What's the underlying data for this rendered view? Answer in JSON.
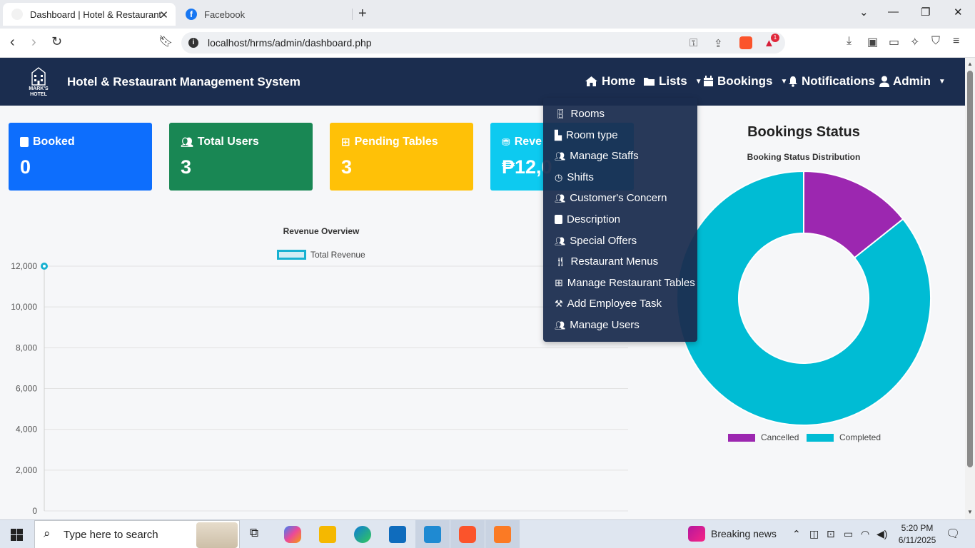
{
  "browser": {
    "tabs": [
      {
        "title": "Dashboard | Hotel & Restaurant",
        "active": true
      },
      {
        "title": "Facebook",
        "active": false
      }
    ],
    "url": "localhost/hrms/admin/dashboard.php",
    "notification_badge": "1"
  },
  "navbar": {
    "logo_text": "MARK'S HOTEL",
    "brand": "Hotel & Restaurant Management System",
    "items": [
      {
        "label": "Home",
        "icon": "home-icon"
      },
      {
        "label": "Lists",
        "icon": "folder-icon",
        "dropdown": true
      },
      {
        "label": "Bookings",
        "icon": "calendar-icon",
        "dropdown": true
      },
      {
        "label": "Notifications",
        "icon": "bell-icon"
      },
      {
        "label": "Admin",
        "icon": "user-icon",
        "dropdown": true
      }
    ]
  },
  "cards": [
    {
      "title": "Booked",
      "value": "0",
      "color": "#0d6efd",
      "icon": "book-icon"
    },
    {
      "title": "Total Users",
      "value": "3",
      "color": "#198754",
      "icon": "users-icon"
    },
    {
      "title": "Pending Tables",
      "value": "3",
      "color": "#ffc107",
      "icon": "table-icon"
    },
    {
      "title": "Reve",
      "value": "₱12,0",
      "color": "#0dcaf0",
      "icon": "coins-icon"
    }
  ],
  "lists_menu": [
    {
      "label": "Rooms",
      "icon": "door-icon"
    },
    {
      "label": "Room type",
      "icon": "building-icon"
    },
    {
      "label": "Manage Staffs",
      "icon": "users-icon"
    },
    {
      "label": "Shifts",
      "icon": "clock-icon"
    },
    {
      "label": "Customer's Concern",
      "icon": "users-icon"
    },
    {
      "label": "Description",
      "icon": "book-icon"
    },
    {
      "label": "Special Offers",
      "icon": "users-icon"
    },
    {
      "label": "Restaurant Menus",
      "icon": "utensils-icon"
    },
    {
      "label": "Manage Restaurant Tables",
      "icon": "table-icon"
    },
    {
      "label": "Add Employee Task",
      "icon": "hammer-icon"
    },
    {
      "label": "Manage Users",
      "icon": "users-icon"
    }
  ],
  "chart_data": [
    {
      "type": "line",
      "title": "Revenue Overview",
      "series": [
        {
          "name": "Total Revenue",
          "color": "#17b1d1",
          "values": [
            12000
          ]
        }
      ],
      "ylim": [
        0,
        12000
      ],
      "yticks": [
        "12,000",
        "10,000",
        "8,000",
        "6,000",
        "4,000",
        "2,000",
        "0"
      ],
      "grid": true,
      "legend": "top"
    },
    {
      "type": "pie",
      "subtype": "donut",
      "title": "Bookings Status",
      "subtitle": "Booking Status Distribution",
      "categories": [
        "Cancelled",
        "Completed"
      ],
      "values": [
        1,
        6
      ],
      "colors": [
        "#9c27b0",
        "#00bcd4"
      ],
      "legend": "bottom"
    }
  ],
  "taskbar": {
    "search_placeholder": "Type here to search",
    "news": "Breaking news",
    "time": "5:20 PM",
    "date": "6/11/2025"
  }
}
